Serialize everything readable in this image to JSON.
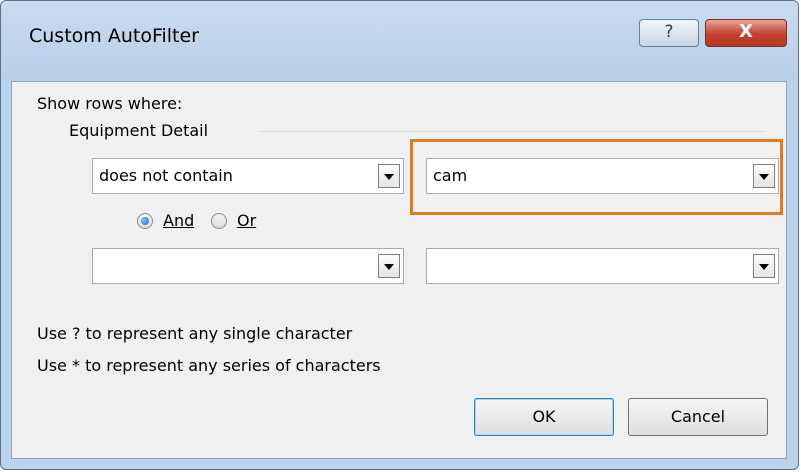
{
  "window": {
    "title": "Custom AutoFilter",
    "help_label": "?",
    "close_label": "X"
  },
  "dialog": {
    "show_rows_label": "Show rows where:",
    "field_name": "Equipment Detail",
    "criteria1": {
      "operator": "does not contain",
      "value": "cam"
    },
    "logic": {
      "and_label": "And",
      "or_label": "Or",
      "selected": "And"
    },
    "criteria2": {
      "operator": "",
      "value": ""
    },
    "hint_single": "Use ? to represent any single character",
    "hint_series": "Use * to represent any series of characters",
    "ok_label": "OK",
    "cancel_label": "Cancel"
  },
  "colors": {
    "highlight": "#e07b1e",
    "close_button": "#c2412f",
    "dialog_frame": "#bcd3ec"
  }
}
